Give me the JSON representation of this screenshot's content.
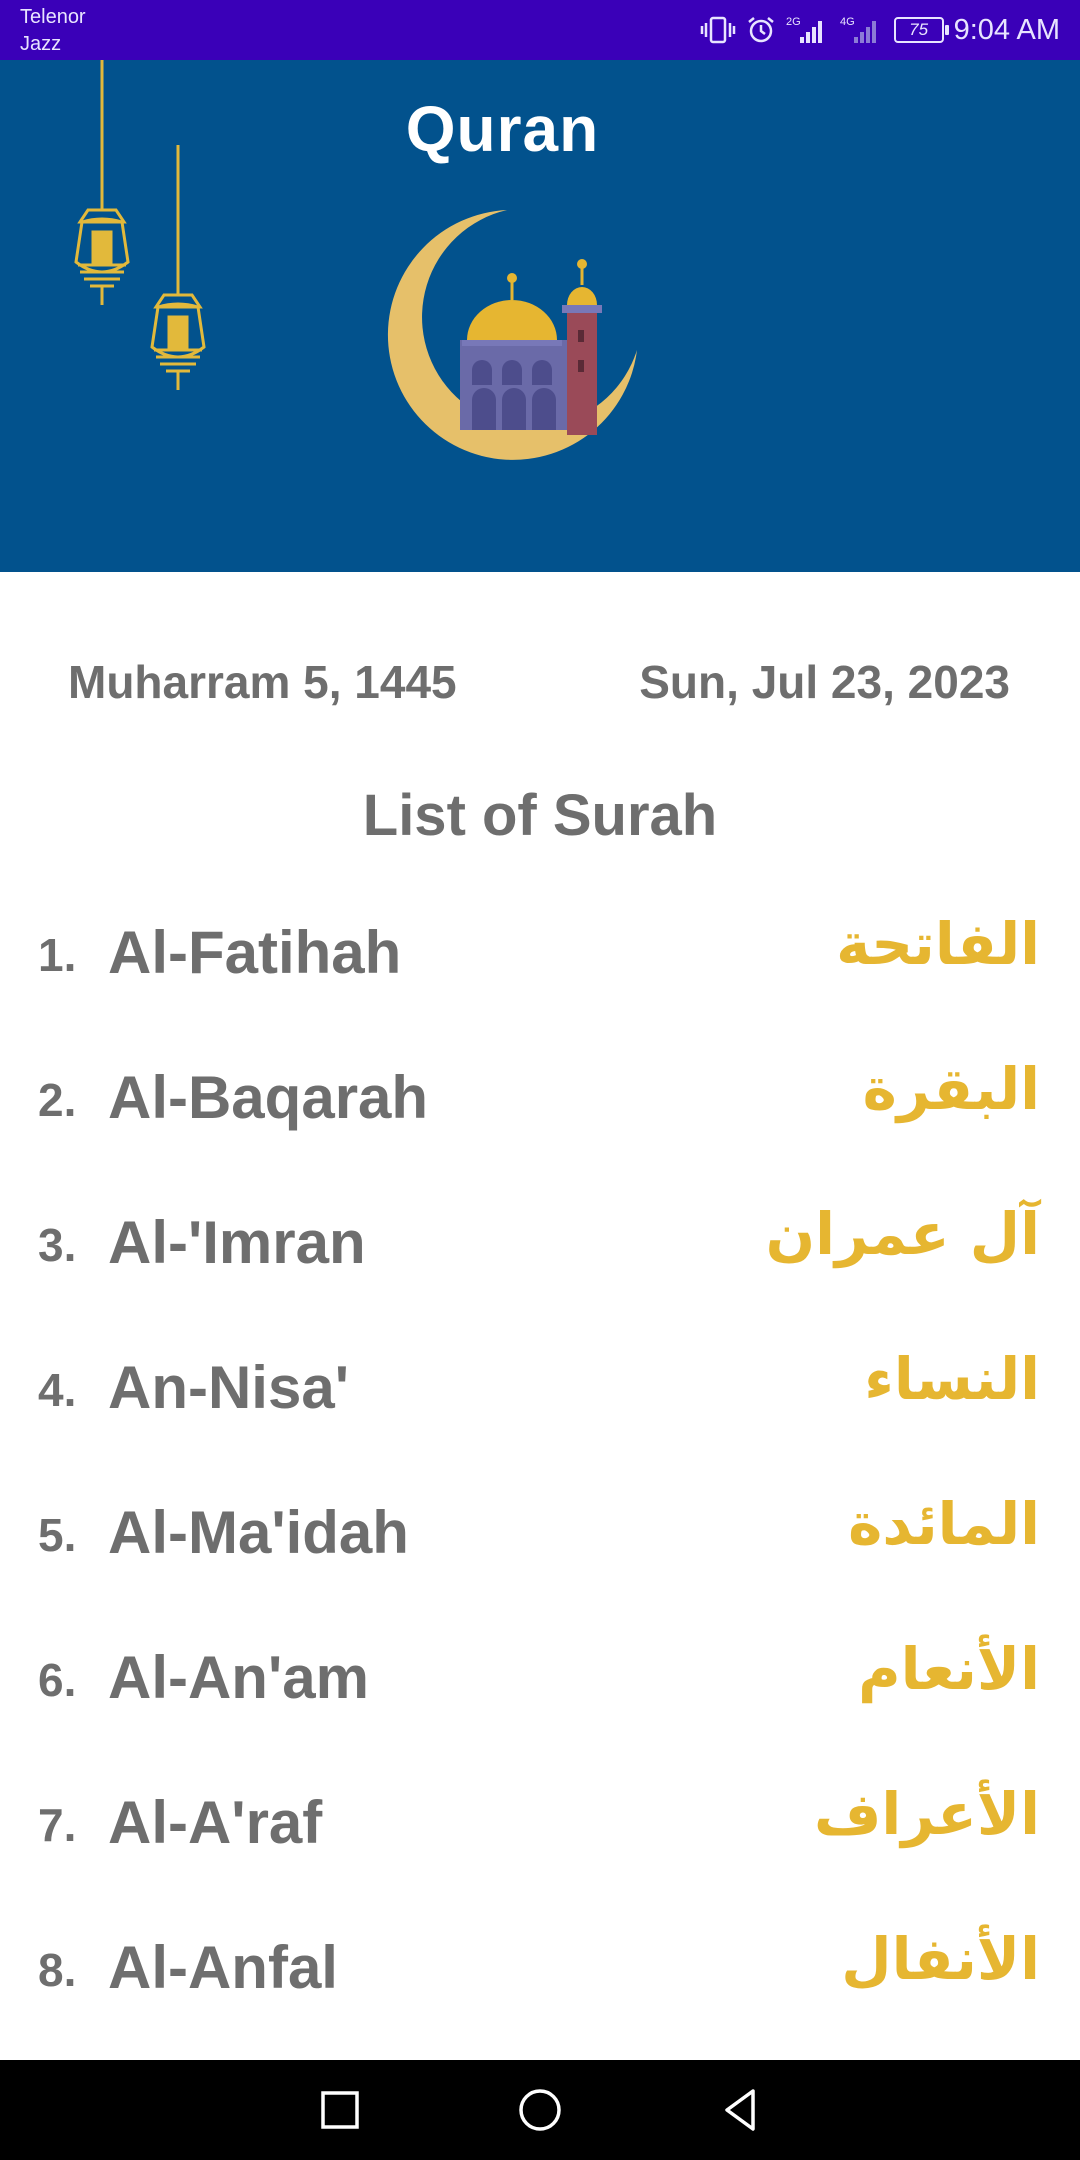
{
  "status_bar": {
    "carrier_line1": "Telenor",
    "carrier_line2": "Jazz",
    "network_1": "2G",
    "network_2": "4G",
    "battery": "75",
    "time": "9:04 AM",
    "icons": [
      "vibrate-icon",
      "alarm-icon",
      "signal-icon",
      "signal-icon-2",
      "battery-icon"
    ]
  },
  "header": {
    "title": "Quran",
    "background_color": "#02528d",
    "images": [
      "lantern-icon",
      "crescent-mosque-icon"
    ]
  },
  "dates": {
    "hijri": "Muharram 5, 1445",
    "gregorian": "Sun, Jul 23, 2023"
  },
  "list": {
    "title": "List of Surah",
    "items": [
      {
        "number": "1.",
        "name": "Al-Fatihah",
        "arabic": "الفاتحة"
      },
      {
        "number": "2.",
        "name": "Al-Baqarah",
        "arabic": "البقرة"
      },
      {
        "number": "3.",
        "name": "Al-'Imran",
        "arabic": "آل عمران"
      },
      {
        "number": "4.",
        "name": "An-Nisa'",
        "arabic": "النساء"
      },
      {
        "number": "5.",
        "name": "Al-Ma'idah",
        "arabic": "المائدة"
      },
      {
        "number": "6.",
        "name": "Al-An'am",
        "arabic": "الأنعام"
      },
      {
        "number": "7.",
        "name": "Al-A'raf",
        "arabic": "الأعراف"
      },
      {
        "number": "8.",
        "name": "Al-Anfal",
        "arabic": "الأنفال"
      }
    ]
  },
  "colors": {
    "accent_gold": "#e6b631",
    "text_gray": "#6e6e6e",
    "status_bar": "#3a00b8"
  },
  "nav": {
    "buttons": [
      "recent-apps-icon",
      "home-icon",
      "back-icon"
    ]
  }
}
